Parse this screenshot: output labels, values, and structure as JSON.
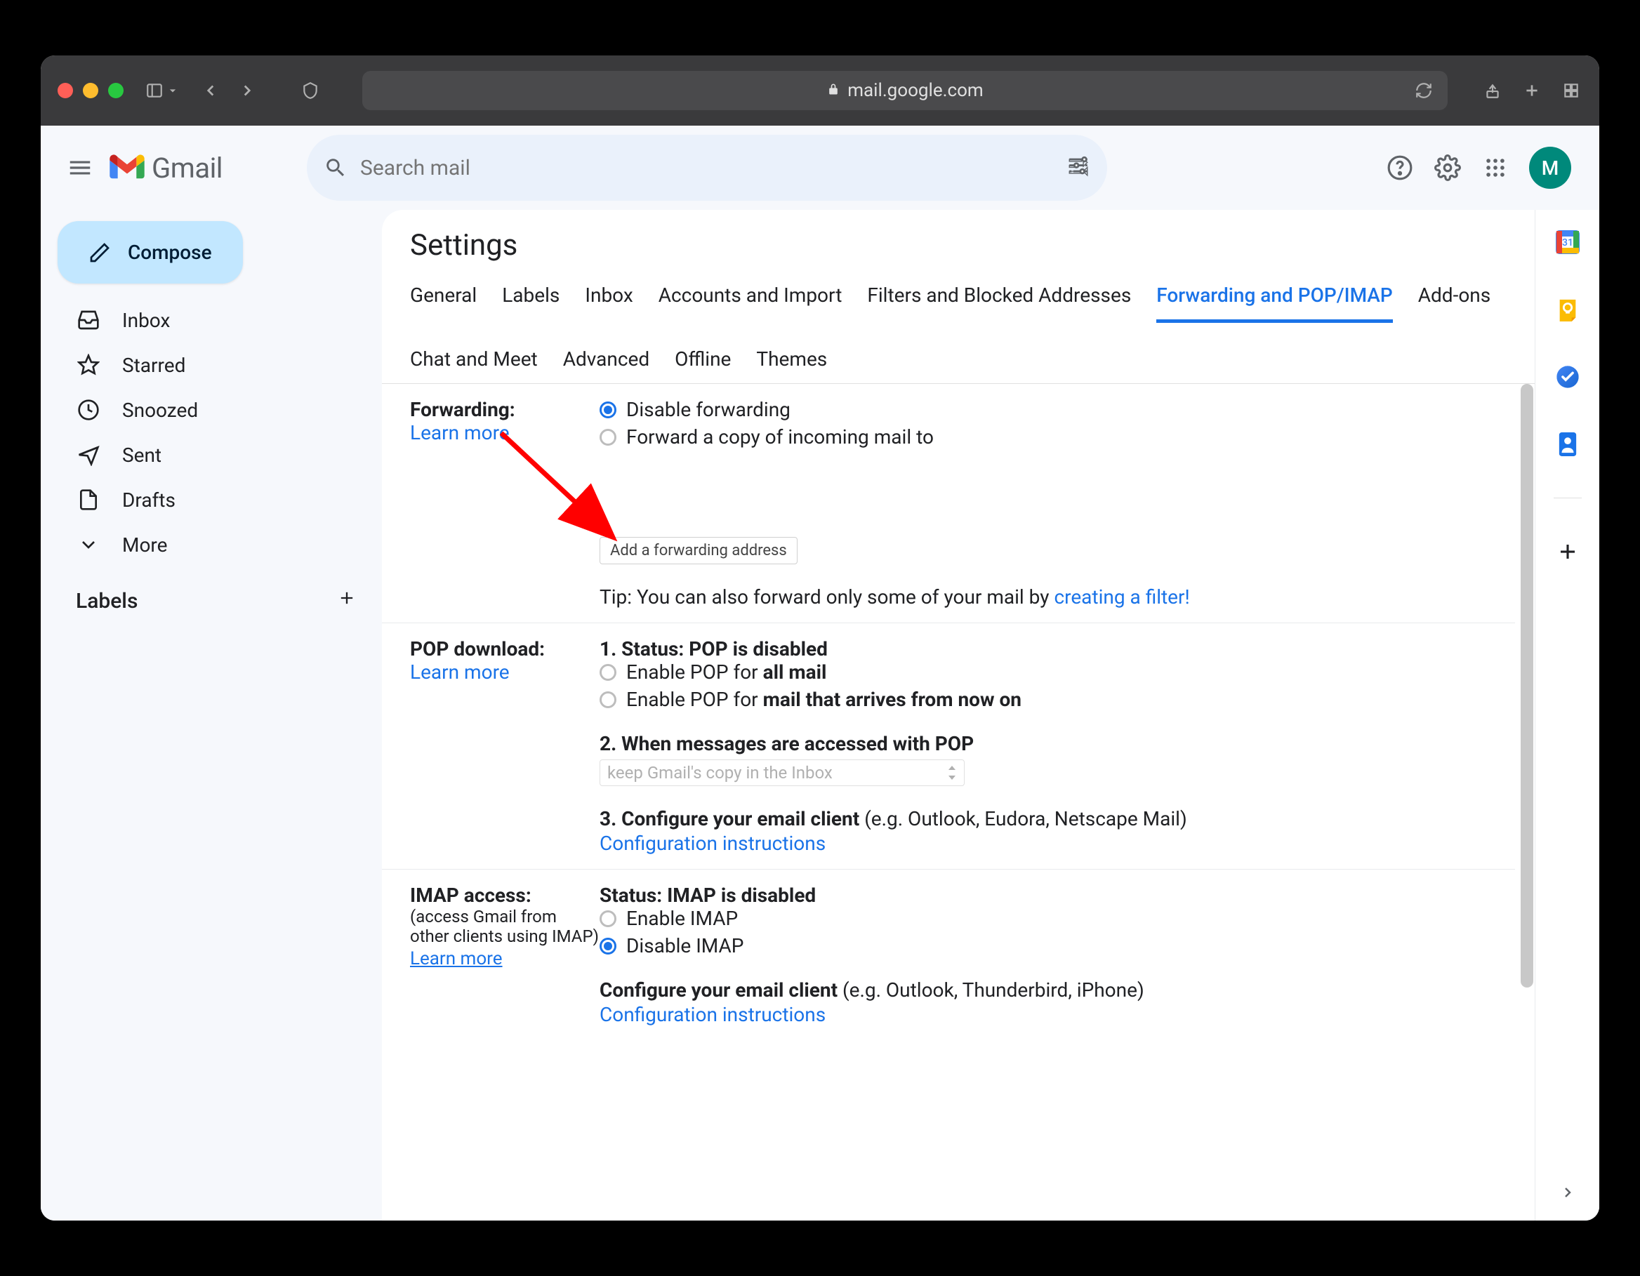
{
  "browser": {
    "url_host": "mail.google.com"
  },
  "gmail": {
    "product_name": "Gmail",
    "search_placeholder": "Search mail",
    "avatar_initial": "M",
    "compose_label": "Compose",
    "nav": {
      "inbox": "Inbox",
      "starred": "Starred",
      "snoozed": "Snoozed",
      "sent": "Sent",
      "drafts": "Drafts",
      "more": "More"
    },
    "labels_header": "Labels"
  },
  "settings": {
    "title": "Settings",
    "tabs": {
      "general": "General",
      "labels": "Labels",
      "inbox": "Inbox",
      "accounts": "Accounts and Import",
      "filters": "Filters and Blocked Addresses",
      "forwarding": "Forwarding and POP/IMAP",
      "addons": "Add-ons",
      "chat": "Chat and Meet",
      "advanced": "Advanced",
      "offline": "Offline",
      "themes": "Themes"
    },
    "forwarding": {
      "section_title": "Forwarding:",
      "learn_more": "Learn more",
      "disable_label": "Disable forwarding",
      "forward_copy_label": "Forward a copy of incoming mail to",
      "add_button": "Add a forwarding address",
      "tip_prefix": "Tip: You can also forward only some of your mail by ",
      "tip_link": "creating a filter!"
    },
    "pop": {
      "section_title": "POP download:",
      "learn_more": "Learn more",
      "status_prefix": "1. Status: ",
      "status_value": "POP is disabled",
      "enable_all_prefix": "Enable POP for ",
      "enable_all_bold": "all mail",
      "enable_now_prefix": "Enable POP for ",
      "enable_now_bold": "mail that arrives from now on",
      "q2": "2. When messages are accessed with POP",
      "q2_select": "keep Gmail's copy in the Inbox",
      "q3_prefix": "3. Configure your email client ",
      "q3_suffix": "(e.g. Outlook, Eudora, Netscape Mail)",
      "config_link": "Configuration instructions"
    },
    "imap": {
      "section_title": "IMAP access:",
      "section_subtitle": "(access Gmail from other clients using IMAP)",
      "learn_more": "Learn more",
      "status_prefix": "Status: ",
      "status_value": "IMAP is disabled",
      "enable_label": "Enable IMAP",
      "disable_label": "Disable IMAP",
      "configure_prefix": "Configure your email client ",
      "configure_suffix": "(e.g. Outlook, Thunderbird, iPhone)",
      "config_link": "Configuration instructions"
    }
  },
  "sidepanel": {
    "calendar_day": "31"
  }
}
